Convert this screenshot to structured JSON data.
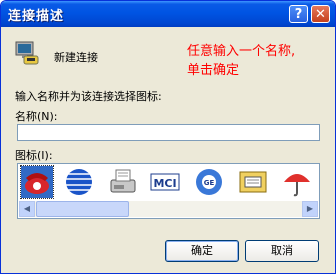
{
  "window": {
    "title": "连接描述",
    "help_glyph": "?",
    "close_glyph": "✕"
  },
  "connection": {
    "name": "新建连接"
  },
  "annotation": {
    "line1": "任意输入一个名称,",
    "line2": "单击确定"
  },
  "form": {
    "prompt": "输入名称并为该连接选择图标:",
    "name_label": "名称(N):",
    "name_value": "",
    "icon_label": "图标(I):"
  },
  "icons": [
    "red-phone-icon",
    "globe-icon",
    "fax-icon",
    "mci-icon",
    "ge-globe-icon",
    "modem-folder-icon",
    "umbrella-icon"
  ],
  "scrollbar": {
    "left_glyph": "◀",
    "right_glyph": "▶"
  },
  "buttons": {
    "ok": "确定",
    "cancel": "取消"
  },
  "colors": {
    "title_bar": "#0054e3",
    "annotation": "#ff0000",
    "dialog_bg": "#ece9d8"
  }
}
